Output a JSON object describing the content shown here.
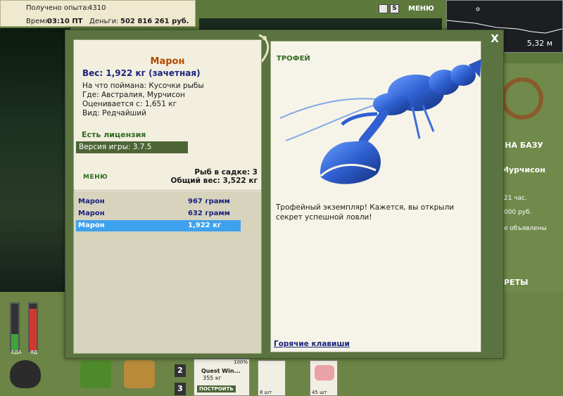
{
  "hud": {
    "experience_label": "Получено опыта:",
    "experience_value": "4310",
    "time_label": "Время:",
    "time_value": "03:10 ПТ",
    "money_label": "Деньги:",
    "money_value": "502 816 261 руб.",
    "menu_label": "МЕНЮ",
    "depth": "5,32 м"
  },
  "background": {
    "base_label": "Я НА БАЗУ",
    "place_label": "Мурчисон",
    "line1": "21 час.",
    "line2": "000 руб.",
    "line3": "е объявлены",
    "secrets_label": "РЕТЫ",
    "gauge_food": "ЕДА",
    "gauge_poison": "ЯД",
    "slot2": "2",
    "slot3": "3",
    "quest_title": "Quest Win...",
    "quest_weight": "355 кг",
    "quest_percent": "100%",
    "build_button": "ПОСТРОИТЬ",
    "bait_count1": "8 шт",
    "bait_count2": "45 шт"
  },
  "dialog": {
    "fish_name": "Марон",
    "fish_weight": "Вес: 1,922 кг (зачетная)",
    "caught_on": "На что поймана: Кусочки рыбы",
    "location": "Где: Австралия, Мурчисон",
    "valued": "Оценивается с: 1,651 кг",
    "kind": "Вид: Редчайший",
    "license": "Есть лицензия",
    "version": "Версия игры: 3.7.5",
    "menu_link": "МЕНЮ",
    "cage_count": "Рыб в садке: 3",
    "total_weight": "Общий вес: 3,522 кг",
    "catches": [
      {
        "name": "Марон",
        "weight": "967 грамм"
      },
      {
        "name": "Марон",
        "weight": "632 грамм"
      },
      {
        "name": "Марон",
        "weight": "1,922 кг"
      }
    ],
    "trophy_label": "ТРОФЕЙ",
    "trophy_text": "Трофейный экземпляр! Кажется, вы открыли секрет успешной ловли!",
    "hotkeys": "Горячие клавиши",
    "close": "X"
  },
  "colors": {
    "accent_green": "#2e6b1f",
    "selected_row": "#3ea1ee",
    "fish_name": "#b44a00",
    "lobster_blue": "#2f5fd0"
  }
}
